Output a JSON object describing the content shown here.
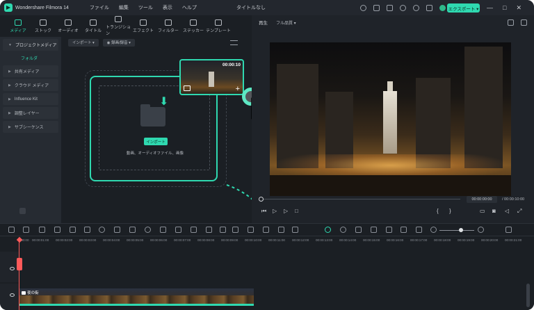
{
  "titlebar": {
    "app_name": "Wondershare Filmora 14",
    "menu": [
      "ファイル",
      "編集",
      "ツール",
      "表示",
      "ヘルプ"
    ],
    "doc_title": "タイトルなし",
    "export_label": "エクスポート ▾",
    "window_controls": [
      "—",
      "□",
      "✕"
    ]
  },
  "toolbar": {
    "tabs": [
      "メディア",
      "ストック",
      "オーディオ",
      "タイトル",
      "トランジション",
      "エフェクト",
      "フィルター",
      "ステッカー",
      "テンプレート"
    ],
    "active_tab": "メディア"
  },
  "sidebar": {
    "project_media": "プロジェクトメディア",
    "folder": "フォルダ",
    "items": [
      "共有メディア",
      "クラウド メディア",
      "Influence Kit",
      "調整レイヤー",
      "サブシーケンス"
    ]
  },
  "media": {
    "import_dropdown": "インポート ▾",
    "record_dropdown": "◉ 録画/録音 ▾",
    "import_button": "インポート",
    "import_hint": "動画、オーディオファイル、画像",
    "thumbnail_duration": "00:00:10"
  },
  "player": {
    "label": "再生",
    "quality": "フル品質 ▾",
    "time_current": "00:00:00:00",
    "time_total": "/ 00:00:10:00"
  },
  "timeline": {
    "ruler": [
      "00:00",
      "00:00:01:00",
      "00:00:02:00",
      "00:00:03:00",
      "00:00:04:00",
      "00:00:05:00",
      "00:00:06:00",
      "00:00:07:00",
      "00:00:08:00",
      "00:00:09:00",
      "00:00:10:00",
      "00:00:11:00",
      "00:00:12:00",
      "00:00:13:00",
      "00:00:14:00",
      "00:00:15:00",
      "00:00:16:00",
      "00:00:17:00",
      "00:00:18:00",
      "00:00:19:00",
      "00:00:20:00",
      "00:00:21:00"
    ],
    "clip_label": "夜の街"
  },
  "colors": {
    "accent": "#2fd9b0",
    "playhead": "#ff5a5a",
    "background": "#1b1f24"
  }
}
